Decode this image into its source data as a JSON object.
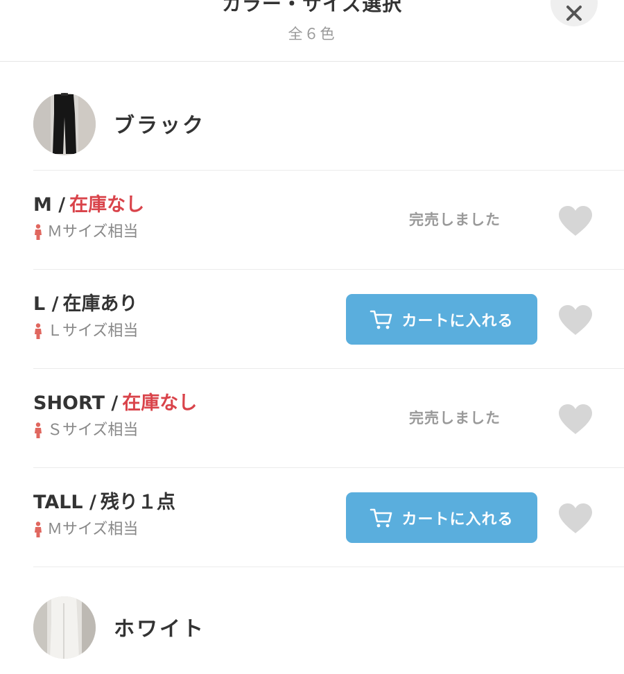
{
  "header": {
    "title": "カラー・サイズ選択",
    "subtitle": "全６色",
    "close_icon": "close-icon"
  },
  "colors": [
    {
      "name": "ブラック",
      "sizes": [
        {
          "size": "M /",
          "stock": "在庫なし",
          "stock_status": "out",
          "fit": "Ｍサイズ相当",
          "action": "sold_out",
          "action_label": "完売しました"
        },
        {
          "size": "L /",
          "stock": "在庫あり",
          "stock_status": "in",
          "fit": "Ｌサイズ相当",
          "action": "cart",
          "action_label": "カートに入れる"
        },
        {
          "size": "SHORT /",
          "stock": "在庫なし",
          "stock_status": "out",
          "fit": "Ｓサイズ相当",
          "action": "sold_out",
          "action_label": "完売しました"
        },
        {
          "size": "TALL /",
          "stock": "残り１点",
          "stock_status": "in",
          "fit": "Ｍサイズ相当",
          "action": "cart",
          "action_label": "カートに入れる"
        }
      ]
    },
    {
      "name": "ホワイト"
    }
  ],
  "icons": {
    "fit": "person-icon",
    "cart": "cart-icon",
    "favorite": "heart-icon"
  },
  "theme": {
    "accent": "#5aaedd",
    "out_of_stock": "#d9434a",
    "heart": "#d6d6d6",
    "muted_text": "#999999"
  }
}
